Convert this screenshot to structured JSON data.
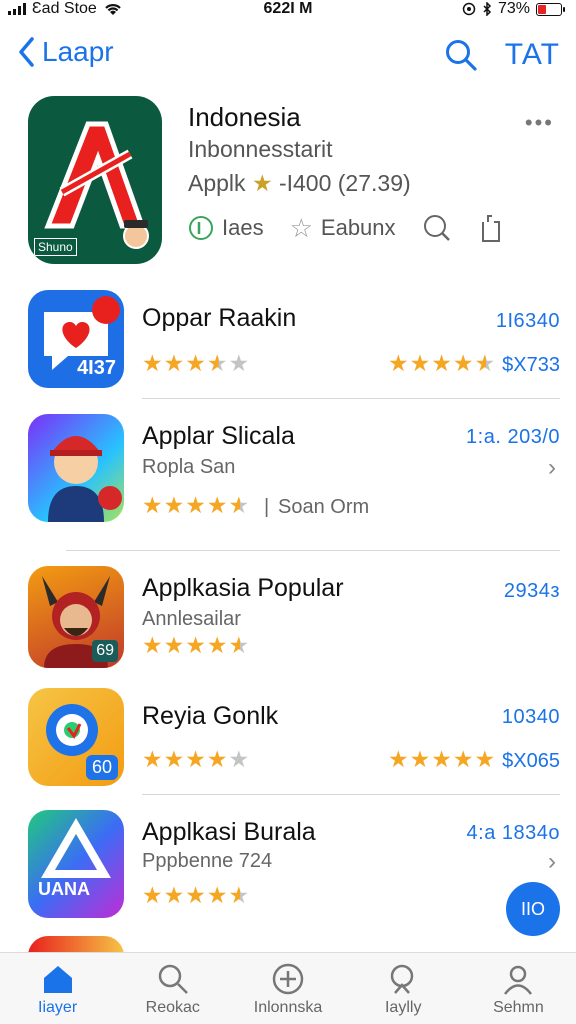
{
  "status_bar": {
    "carrier": "Ɛad Stoe",
    "time": "622I M",
    "battery": "73%"
  },
  "nav": {
    "back_label": "Laapr",
    "right_label": "TAT"
  },
  "featured": {
    "title": "Indonesia",
    "subtitle": "Inbonnesstarit",
    "meta_prefix": "Applk",
    "meta_suffix": "-I400 (27.39)",
    "icon_badge": "Shuno",
    "more": "•••",
    "actions": {
      "first": "Iaes",
      "second": "Eabunx"
    }
  },
  "apps": [
    {
      "name": "Oppar Raakin",
      "badge": "4I37",
      "price": "1I6340",
      "price2": "$X733",
      "rating": 3.5,
      "rating2": 4.5
    },
    {
      "name": "Applar Slicala",
      "sub": "Ropla San",
      "price": "1:a. 203/0",
      "separator": "|",
      "extra": "Soan Orm",
      "rating": 4.5
    },
    {
      "name": "Applkasia Popular",
      "sub": "Annlesailar",
      "badge": "69",
      "price": "2934з",
      "rating": 4.5
    },
    {
      "name": "Reyia Gonlk",
      "badge": "60",
      "price": "10340",
      "price2": "$X065",
      "rating": 4,
      "rating2": 5
    },
    {
      "name": "Applkasi Burala",
      "sub": "Pppbenne 724",
      "badge": "UANA",
      "price": "4:a 1834o",
      "rating": 4.5
    }
  ],
  "fab_label": "IIO",
  "tabs": [
    {
      "label": "Iiayer",
      "icon": "home-icon",
      "active": true
    },
    {
      "label": "Reokac",
      "icon": "search-icon",
      "active": false
    },
    {
      "label": "Inlonnska",
      "icon": "plus-circle-icon",
      "active": false
    },
    {
      "label": "Iaylly",
      "icon": "search-icon",
      "active": false
    },
    {
      "label": "Sehmn",
      "icon": "person-icon",
      "active": false
    }
  ],
  "colors": {
    "accent": "#1a73e8",
    "star": "#f5a623",
    "featured_icon_bg": "#0b5a40"
  }
}
